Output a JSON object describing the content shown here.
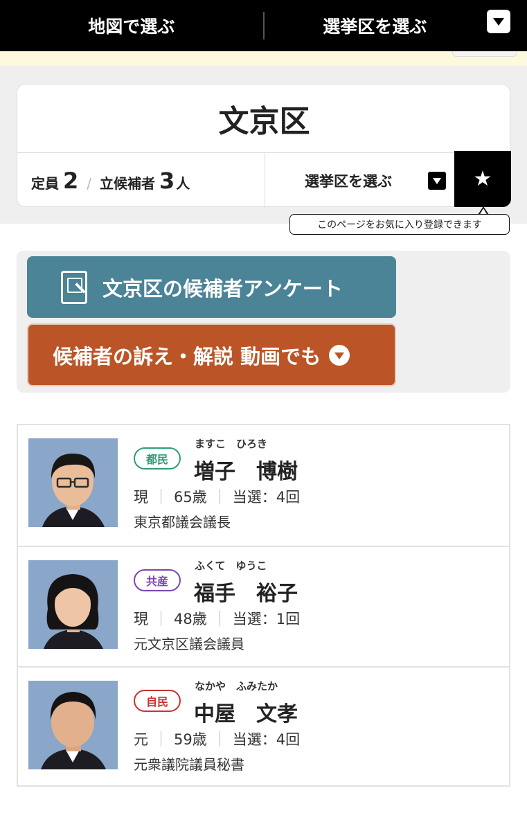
{
  "nav": {
    "map_select": "地図で選ぶ",
    "district_select": "選挙区を選ぶ"
  },
  "district": {
    "name": "文京区",
    "seats_label": "定員",
    "seats": "2",
    "candidates_label": "立候補者",
    "candidates": "3",
    "candidates_unit": "人",
    "select_label": "選挙区を選ぶ",
    "favorite_tooltip": "このページをお気に入り登録できます"
  },
  "actions": {
    "survey_label": "文京区の候補者アンケート",
    "video_label": "候補者の訴え・解説 動画でも"
  },
  "candidates": [
    {
      "party": "都民",
      "party_color": "#2e9c74",
      "furigana": "ますこ　ひろき",
      "name": "増子　博樹",
      "status": "現",
      "age": "65歳",
      "wins": "当選：4回",
      "title": "東京都議会議長"
    },
    {
      "party": "共産",
      "party_color": "#7b45b0",
      "furigana": "ふくて　ゆうこ",
      "name": "福手　裕子",
      "status": "現",
      "age": "48歳",
      "wins": "当選：1回",
      "title": "元文京区議会議員"
    },
    {
      "party": "自民",
      "party_color": "#c8332f",
      "furigana": "なかや　ふみたか",
      "name": "中屋　文孝",
      "status": "元",
      "age": "59歳",
      "wins": "当選：4回",
      "title": "元衆議院議員秘書"
    }
  ]
}
